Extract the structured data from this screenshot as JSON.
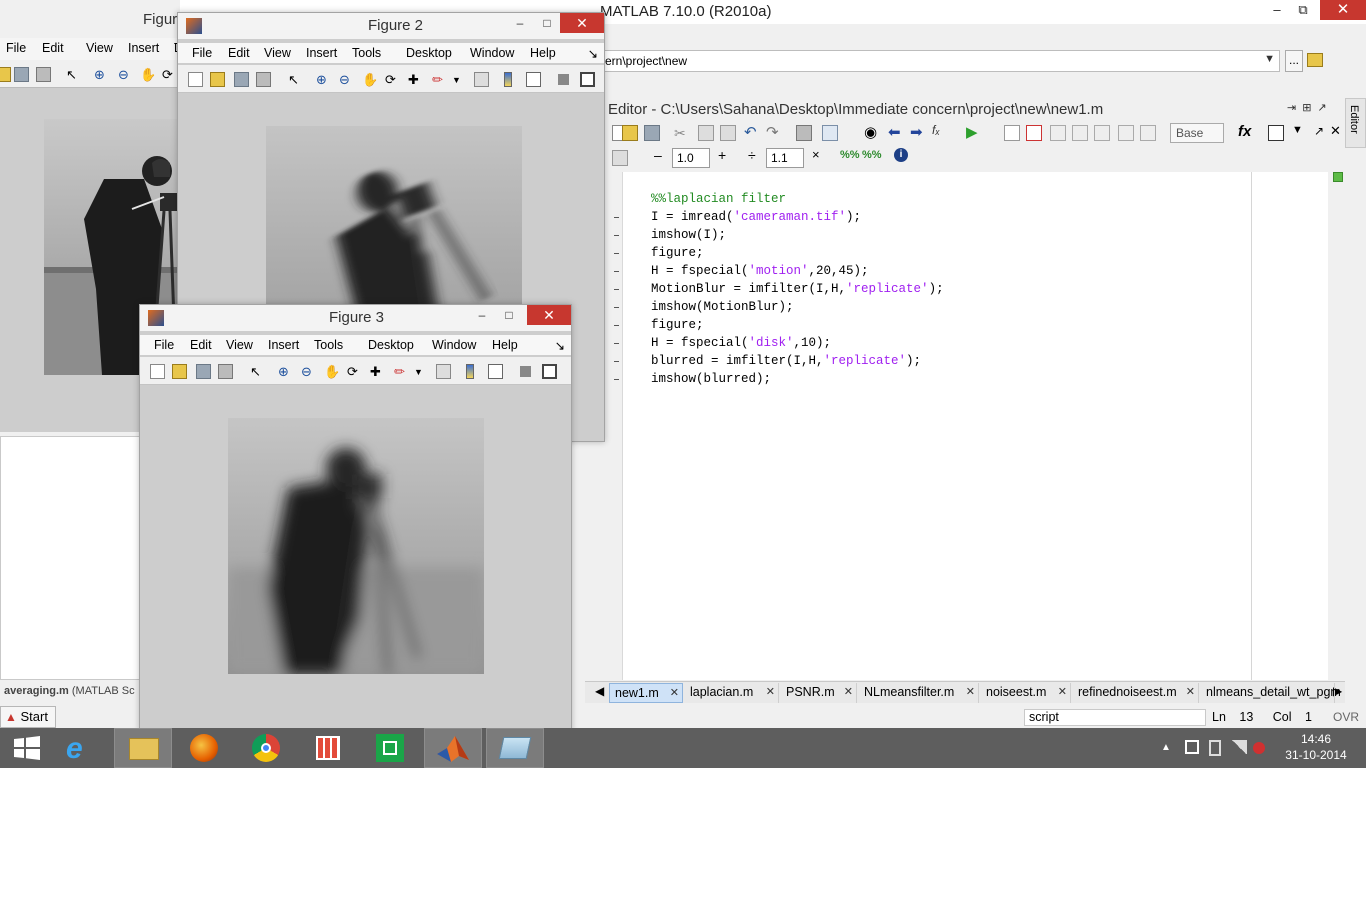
{
  "main_window": {
    "title": "MATLAB  7.10.0 (R2010a)",
    "current_folder_path": "ern\\project\\new",
    "browse_label": "..."
  },
  "editor": {
    "title": "Editor - C:\\Users\\Sahana\\Desktop\\Immediate concern\\project\\new\\new1.m",
    "side_tab_label": "Editor",
    "base_selector": "Base",
    "cell_increment_a": "1.0",
    "cell_increment_b": "1.1",
    "code_lines": [
      {
        "parts": [
          {
            "t": "%%laplacian filter",
            "c": "cmt"
          }
        ]
      },
      {
        "parts": [
          {
            "t": "I = imread(",
            "c": ""
          },
          {
            "t": "'cameraman.tif'",
            "c": "str"
          },
          {
            "t": ");",
            "c": ""
          }
        ]
      },
      {
        "parts": [
          {
            "t": "imshow(I);",
            "c": ""
          }
        ]
      },
      {
        "parts": [
          {
            "t": "figure;",
            "c": ""
          }
        ]
      },
      {
        "parts": [
          {
            "t": "H = fspecial(",
            "c": ""
          },
          {
            "t": "'motion'",
            "c": "str"
          },
          {
            "t": ",20,45);",
            "c": ""
          }
        ]
      },
      {
        "parts": [
          {
            "t": "MotionBlur = imfilter(I,H,",
            "c": ""
          },
          {
            "t": "'replicate'",
            "c": "str"
          },
          {
            "t": ");",
            "c": ""
          }
        ]
      },
      {
        "parts": [
          {
            "t": "imshow(MotionBlur);",
            "c": ""
          }
        ]
      },
      {
        "parts": [
          {
            "t": "figure;",
            "c": ""
          }
        ]
      },
      {
        "parts": [
          {
            "t": "H = fspecial(",
            "c": ""
          },
          {
            "t": "'disk'",
            "c": "str"
          },
          {
            "t": ",10);",
            "c": ""
          }
        ]
      },
      {
        "parts": [
          {
            "t": "blurred = imfilter(I,H,",
            "c": ""
          },
          {
            "t": "'replicate'",
            "c": "str"
          },
          {
            "t": ");",
            "c": ""
          }
        ]
      },
      {
        "parts": [
          {
            "t": "imshow(blurred);",
            "c": ""
          }
        ]
      }
    ],
    "tabs": [
      {
        "label": "new1.m",
        "active": true
      },
      {
        "label": "laplacian.m",
        "active": false
      },
      {
        "label": "PSNR.m",
        "active": false
      },
      {
        "label": "NLmeansfilter.m",
        "active": false
      },
      {
        "label": "noiseest.m",
        "active": false
      },
      {
        "label": "refinednoiseest.m",
        "active": false
      },
      {
        "label": "nlmeans_detail_wt_pgm",
        "active": false
      }
    ],
    "status": {
      "mode": "script",
      "ln_label": "Ln",
      "ln_value": "13",
      "col_label": "Col",
      "col_value": "1",
      "ovr": "OVR"
    }
  },
  "figure1": {
    "title": "Figur",
    "menu": [
      "File",
      "Edit",
      "View",
      "Insert",
      "Tools",
      "D"
    ]
  },
  "figure2": {
    "title": "Figure 2",
    "menu": [
      "File",
      "Edit",
      "View",
      "Insert",
      "Tools",
      "Desktop",
      "Window",
      "Help"
    ]
  },
  "figure3": {
    "title": "Figure 3",
    "menu": [
      "File",
      "Edit",
      "View",
      "Insert",
      "Tools",
      "Desktop",
      "Window",
      "Help"
    ]
  },
  "folder_panel": {
    "detail_file": "averaging.m",
    "detail_type": "(MATLAB Sc"
  },
  "start_button": "Start",
  "taskbar": {
    "apps": [
      "windows-start",
      "internet-explorer",
      "file-explorer",
      "firefox",
      "chrome",
      "apps",
      "store",
      "matlab",
      "notepad"
    ],
    "clock_time": "14:46",
    "clock_date": "31-10-2014"
  },
  "colors": {
    "close_red": "#c7372f",
    "comment_green": "#228b22",
    "string_purple": "#a020f0",
    "taskbar": "#5e5e5e"
  }
}
